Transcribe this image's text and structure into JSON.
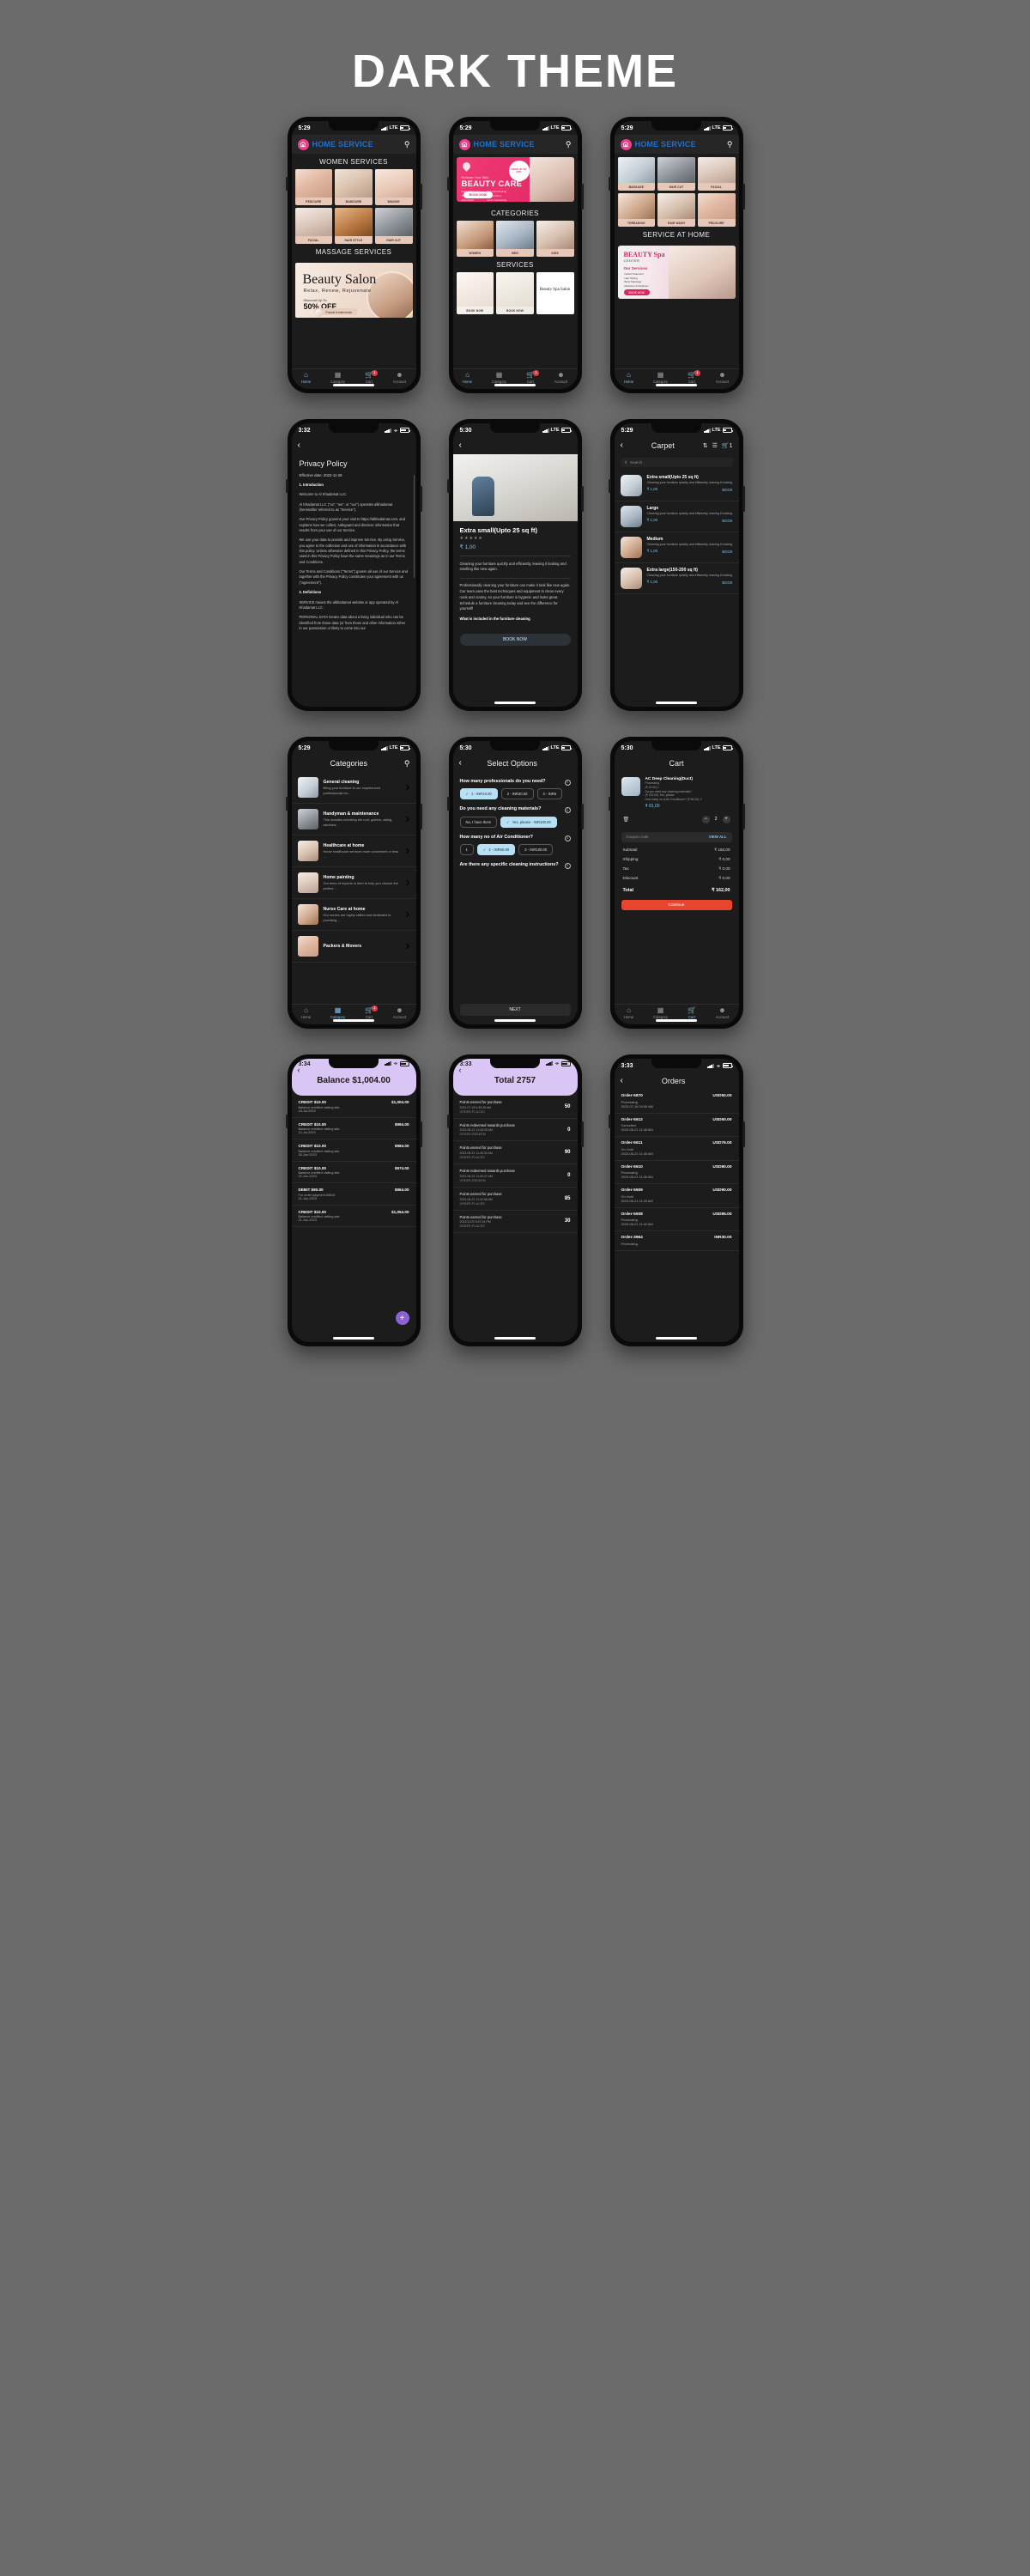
{
  "page": {
    "title": "DARK THEME"
  },
  "common": {
    "brand": "HOME SERVICE",
    "search_icon": "search-icon",
    "home_icon": "home-icon",
    "tabs": [
      {
        "label": "Home",
        "icon": "home-icon"
      },
      {
        "label": "Category",
        "icon": "grid-icon"
      },
      {
        "label": "Cart",
        "icon": "cart-icon",
        "badge": "1"
      },
      {
        "label": "Account",
        "icon": "person-icon"
      }
    ]
  },
  "screens": {
    "home_women": {
      "time": "5:29",
      "network": "LTE",
      "section1": "WOMEN SERVICES",
      "tiles1": [
        {
          "caption": "PEDICURE"
        },
        {
          "caption": "MANICURE"
        },
        {
          "caption": "WAXING"
        },
        {
          "caption": "FACIAL"
        },
        {
          "caption": "HAIR STYLE"
        },
        {
          "caption": "HAIR CUT"
        }
      ],
      "section2": "MASSAGE SERVICES",
      "banner": {
        "title": "Beauty Salon",
        "subtitle": "Relax, Renew, Rejuvenate",
        "discount_label": "Discount Up To",
        "discount_value": "50% OFF",
        "pill": "Facial treatments"
      }
    },
    "home_beauty": {
      "time": "5:29",
      "network": "LTE",
      "promo": {
        "eyebrow": "Refresh Your Skin",
        "title": "BEAUTY CARE",
        "badge": "SAVE UP TO 60%",
        "items": [
          "Facial Whitening",
          "Chemical Peeling",
          "Threadlift",
          "Dermal fillers",
          "Auto Roller",
          "Laser resurfacing"
        ],
        "cta": "BOOK NOW"
      },
      "section_categories": "CATEGORIES",
      "categories": [
        {
          "caption": "WOMEN"
        },
        {
          "caption": "MEN"
        },
        {
          "caption": "KIDS"
        }
      ],
      "section_services": "SERVICES",
      "services": [
        {
          "caption": "BOOK NOW",
          "title": "Shoba Shalan BEAUTY SALON"
        },
        {
          "caption": "BOOK NOW",
          "title": ""
        },
        {
          "caption": "",
          "title": "Beauty Spa Salon"
        }
      ]
    },
    "home_service_at_home": {
      "time": "5:29",
      "network": "LTE",
      "tiles": [
        {
          "caption": "MASSAGE"
        },
        {
          "caption": "HAIR CUT"
        },
        {
          "caption": "FACIAL"
        },
        {
          "caption": "THREADING"
        },
        {
          "caption": "HAIR WASH"
        },
        {
          "caption": "PEDICURE"
        }
      ],
      "section": "SERVICE AT HOME",
      "card": {
        "title": "BEAUTY Spa",
        "subtitle": "CENTER",
        "services_label": "Our Services",
        "services": [
          "Facial Treatment",
          "Hair Styling",
          "Body Massage",
          "Manicure & Pedicure"
        ],
        "cta": "BOOK NOW"
      }
    },
    "privacy": {
      "time": "3:32",
      "title": "Privacy Policy",
      "effective": "Effective date: 2022-11-28",
      "paragraphs": [
        {
          "heading": "1. Introduction"
        },
        {
          "text": "Welcome to Al Khadamat LLC."
        },
        {
          "text": "Al Khadamat LLC (\"us\", \"we\", or \"our\") operates alkhadamat (hereinafter referred to as \"Service\")."
        },
        {
          "text": "Our Privacy Policy governs your visit to https://alkhadamat.com, and explains how we collect, safeguard and disclose information that results from your use of our Service."
        },
        {
          "text": "We use your data to provide and improve Service. By using Service, you agree to the collection and use of information in accordance with this policy. Unless otherwise defined in this Privacy Policy, the terms used in this Privacy Policy have the same meanings as in our Terms and Conditions."
        },
        {
          "text": "Our Terms and Conditions (\"Terms\") govern all use of our Service and together with the Privacy Policy constitutes your agreement with us (\"agreement\")."
        },
        {
          "heading": "2. Definitions"
        },
        {
          "text": "SERVICE means the alkhadamat website or app operated by Al Khadamat LLC."
        },
        {
          "text": "PERSONAL DATA means data about a living individual who can be identified from those data (or from those and other information either in our possession or likely to come into our"
        }
      ]
    },
    "detail": {
      "time": "5:30",
      "network": "LTE",
      "title": "Extra small(Upto 25 sq ft)",
      "stars": "★★★★★",
      "price": "₹ 1,00",
      "short_desc": "Cleaning your furniture quickly and efficiently, leaving it looking and smelling like new again.",
      "long_desc": "Professionally cleaning your furniture can make it look like new again. Our team uses the best techniques and equipment to clean every nook and cranny, so your furniture is hygienic and looks great. Schedule a furniture cleaning today and see the difference for yourself!",
      "included_label": "What is included in the furniture cleaning",
      "cta": "BOOK NOW"
    },
    "carpet": {
      "time": "5:29",
      "network": "LTE",
      "title": "Carpet",
      "sort_icon": "sort-icon",
      "filter_icon": "filter-icon",
      "cart_badge": "1",
      "search_placeholder": "Search",
      "items": [
        {
          "name": "Extra small(Upto 25 sq ft)",
          "desc": "Cleaning your furniture quickly and efficiently, leaving it looking",
          "price": "₹ 1,00",
          "action": "BOOK"
        },
        {
          "name": "Large",
          "desc": "Cleaning your furniture quickly and efficiently, leaving it looking",
          "price": "₹ 1,00",
          "action": "BOOK"
        },
        {
          "name": "Medium",
          "desc": "Cleaning your furniture quickly and efficiently, leaving it looking",
          "price": "₹ 1,00",
          "action": "BOOK"
        },
        {
          "name": "Extra large(150-200 sq ft)",
          "desc": "Cleaning your furniture quickly and efficiently, leaving it looking",
          "price": "₹ 1,00",
          "action": "BOOK"
        }
      ]
    },
    "categories": {
      "time": "5:29",
      "network": "LTE",
      "title": "Categories",
      "items": [
        {
          "name": "General cleaning",
          "desc": "Bring your furniture to our experienced professionals for..."
        },
        {
          "name": "Handyman & maintenance",
          "desc": "This includes checking the roof, gutters, siding, windows..."
        },
        {
          "name": "Healthcare at home",
          "desc": "Home healthcare services more convenient or less ..."
        },
        {
          "name": "Home painting",
          "desc": "Our team of experts is here to help you choose the perfect ..."
        },
        {
          "name": "Nurse Care at home",
          "desc": "Our nurses are highly skilled and dedicated to providing ..."
        },
        {
          "name": "Packers & Movers",
          "desc": ""
        }
      ]
    },
    "select_options": {
      "time": "5:30",
      "network": "LTE",
      "title": "Select Options",
      "questions": [
        {
          "q": "How many professionals do you need?",
          "options": [
            {
              "label": "1  - INR10.00",
              "selected": true
            },
            {
              "label": "2  - INR30.00",
              "selected": false
            },
            {
              "label": "3  - INR6",
              "selected": false
            }
          ]
        },
        {
          "q": "Do you need any cleaning materials?",
          "options": [
            {
              "label": "No, I have them",
              "selected": false
            },
            {
              "label": "Yes, please  - INR100.00",
              "selected": true
            }
          ]
        },
        {
          "q": "How many no of Air Conditioner?",
          "options": [
            {
              "label": "1",
              "selected": false
            },
            {
              "label": "2  - INR50.00",
              "selected": true
            },
            {
              "label": "3  - INR100.00",
              "selected": false
            }
          ]
        },
        {
          "q": "Are there any specific cleaning instructions?",
          "options": []
        }
      ],
      "next": "NEXT"
    },
    "cart": {
      "time": "5:30",
      "network": "LTE",
      "title": "Cart",
      "item": {
        "name": "AC Deep  Cleaning(Duct)",
        "lines": [
          "Processing",
          "(₹ 10,00) 1",
          "Do you need any cleaning materials?",
          "(₹ 100,00): Yes, please",
          "How many no of Air Conditioner? (₹ 50,00): 2"
        ],
        "price": "₹ 81,00",
        "qty": "2"
      },
      "coupon_placeholder": "Coupon code",
      "view_all": "VIEW ALL",
      "summary": [
        {
          "label": "Subtotal",
          "value": "₹ 162,00"
        },
        {
          "label": "Shipping",
          "value": "₹ 0,00"
        },
        {
          "label": "Tax",
          "value": "₹ 0,00"
        },
        {
          "label": "Discount",
          "value": "₹ 0,00"
        }
      ],
      "total_label": "Total",
      "total_value": "₹ 162,00",
      "continue": "Continue"
    },
    "balance": {
      "time": "3:34",
      "title": "Balance $1,004.00",
      "fab": "+",
      "rows": [
        {
          "type": "CREDIT $10.00",
          "amount": "$1,004.00",
          "note": "Balance credited visiting site.",
          "date": "18-Jul-2023"
        },
        {
          "type": "CREDIT $10.00",
          "amount": "$994.00",
          "note": "Balance credited visiting site.",
          "date": "12-Jul-2023"
        },
        {
          "type": "CREDIT $10.00",
          "amount": "$984.00",
          "note": "Balance credited visiting site.",
          "date": "26-Jun-2023"
        },
        {
          "type": "CREDIT $10.00",
          "amount": "$974.00",
          "note": "Balance credited visiting site.",
          "date": "22-Jun-2023"
        },
        {
          "type": "DEBIT $90.00",
          "amount": "$964.00",
          "note": "For order payment #5510",
          "date": "21-Jun-2023"
        },
        {
          "type": "CREDIT $10.00",
          "amount": "$1,054.00",
          "note": "Balance credited visiting site.",
          "date": "21-Jun-2023"
        }
      ]
    },
    "points": {
      "time": "3:33",
      "title": "Total 2757",
      "rows": [
        {
          "t": "Points earned for purchase",
          "s": "2023-07-18 4:39:38 AM",
          "k": "ORDER-PLACED",
          "v": "50"
        },
        {
          "t": "Points redeemed towards purchase",
          "s": "2023-06-21 11:46:25 AM",
          "k": "ORDER-REDEEM",
          "v": "0"
        },
        {
          "t": "Points earned for purchase",
          "s": "2023-06-21 11:45:33 AM",
          "k": "ORDER-PLACED",
          "v": "90"
        },
        {
          "t": "Points redeemed towards purchase",
          "s": "2023-06-21 11:44:47 AM",
          "k": "ORDER-REDEEM",
          "v": "0"
        },
        {
          "t": "Points earned for purchase",
          "s": "2023-06-21 11:42:56 AM",
          "k": "ORDER-PLACED",
          "v": "85"
        },
        {
          "t": "Points earned for purchase",
          "s": "2022/11/23 5:57:34 PM",
          "k": "ORDER-PLACED",
          "v": "30"
        }
      ]
    },
    "orders": {
      "time": "3:33",
      "title": "Orders",
      "rows": [
        {
          "id": "Order-5870",
          "amount": "USD50.00",
          "status": "Processing",
          "date": "2023-07-18 04:59 AM"
        },
        {
          "id": "Order-5512",
          "amount": "USD50.00",
          "status": "Cancelled",
          "date": "2023-06-21 11:46 AM"
        },
        {
          "id": "Order-5511",
          "amount": "USD76.00",
          "status": "On Hold",
          "date": "2023-06-21 11:46 AM"
        },
        {
          "id": "Order-5510",
          "amount": "USD90.00",
          "status": "Processing",
          "date": "2023-06-21 11:45 AM"
        },
        {
          "id": "Order-5509",
          "amount": "USD90.00",
          "status": "On Hold",
          "date": "2023-06-21 11:43 AM"
        },
        {
          "id": "Order-5508",
          "amount": "USD85.00",
          "status": "Processing",
          "date": "2023-06-21 11:42 AM"
        },
        {
          "id": "Order-3964",
          "amount": "INR30.00",
          "status": "Processing",
          "date": "2022-11-23 05:57 PM"
        }
      ]
    }
  },
  "colors": {
    "accent_pink": "#ee3d8b",
    "brand_blue": "#1f6fd0",
    "link_blue": "#7cc3f0",
    "danger": "#e8452f",
    "lavender": "#d9c6f5",
    "background": "#6b6b6b"
  }
}
